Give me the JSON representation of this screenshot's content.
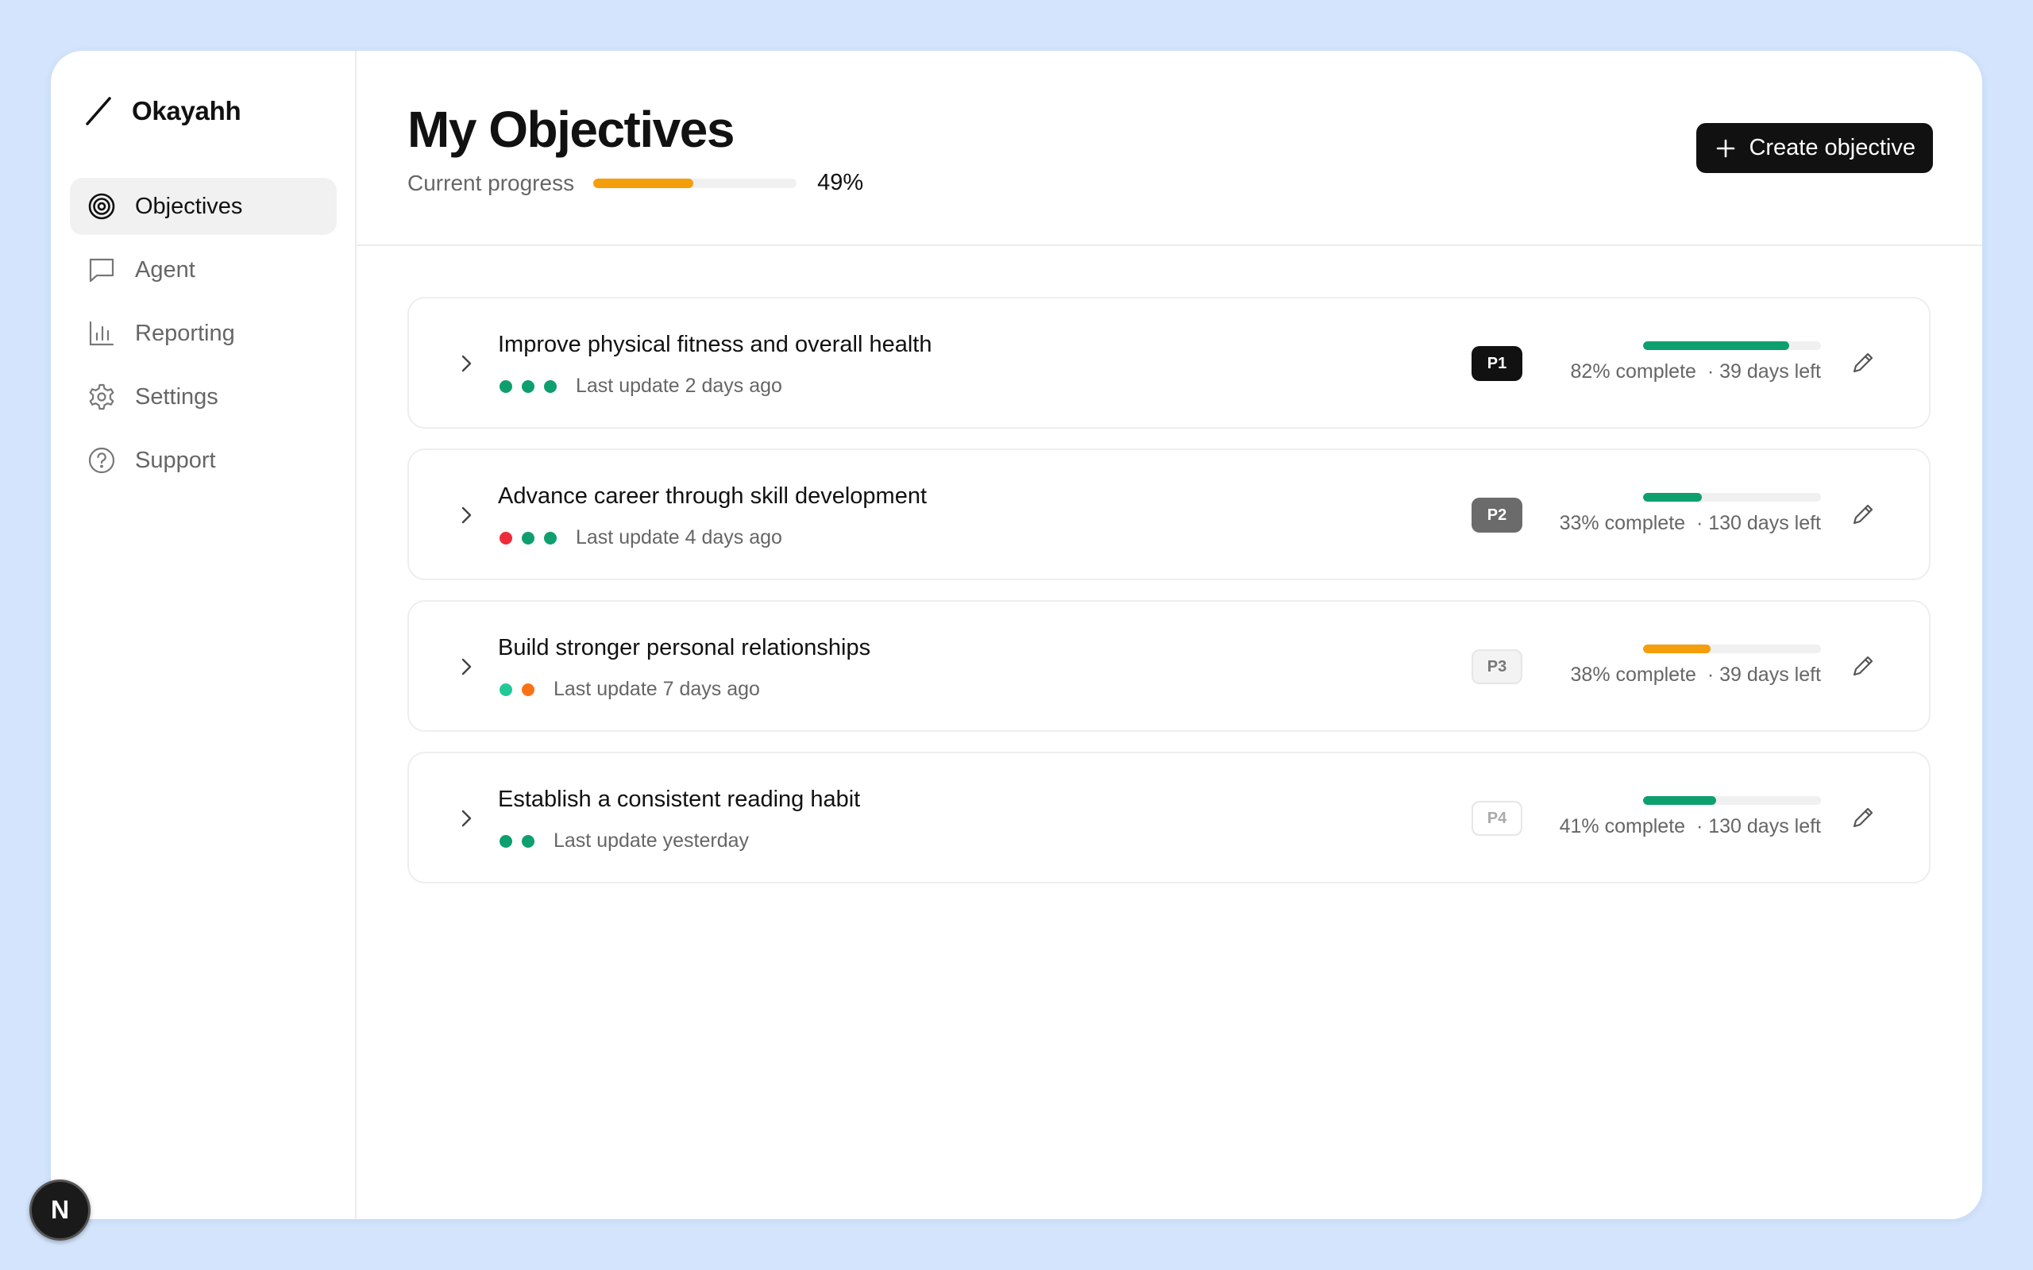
{
  "brand": {
    "name": "Okayahh"
  },
  "sidebar": {
    "items": [
      {
        "label": "Objectives",
        "icon": "target-icon",
        "active": true
      },
      {
        "label": "Agent",
        "icon": "chat-icon",
        "active": false
      },
      {
        "label": "Reporting",
        "icon": "bar-chart-icon",
        "active": false
      },
      {
        "label": "Settings",
        "icon": "gear-icon",
        "active": false
      },
      {
        "label": "Support",
        "icon": "help-circle-icon",
        "active": false
      }
    ]
  },
  "header": {
    "title": "My Objectives",
    "progress_label": "Current progress",
    "progress_value": "49%",
    "progress_fraction": 0.49,
    "create_label": "Create objective"
  },
  "objectives": [
    {
      "title": "Improve physical fitness and overall health",
      "dots": [
        "#0e9f6e",
        "#0e9f6e",
        "#0e9f6e"
      ],
      "last_update": "Last update 2 days ago",
      "priority": "P1",
      "percent": 0.82,
      "bar_color": "#0e9f6e",
      "complete_text": "82% complete",
      "days_text": "· 39 days left"
    },
    {
      "title": "Advance career through skill development",
      "dots": [
        "#ef2b3b",
        "#0e9f6e",
        "#0e9f6e"
      ],
      "last_update": "Last update 4 days ago",
      "priority": "P2",
      "percent": 0.33,
      "bar_color": "#0e9f6e",
      "complete_text": "33% complete",
      "days_text": "· 130 days left"
    },
    {
      "title": "Build stronger personal relationships",
      "dots": [
        "#22c997",
        "#f97316"
      ],
      "last_update": "Last update 7 days ago",
      "priority": "P3",
      "percent": 0.38,
      "bar_color": "#f59e0b",
      "complete_text": "38% complete",
      "days_text": "· 39 days left"
    },
    {
      "title": "Establish a consistent reading habit",
      "dots": [
        "#0e9f6e",
        "#0e9f6e"
      ],
      "last_update": "Last update yesterday",
      "priority": "P4",
      "percent": 0.41,
      "bar_color": "#0e9f6e",
      "complete_text": "41% complete",
      "days_text": "· 130 days left"
    }
  ],
  "fab": {
    "label": "N"
  }
}
